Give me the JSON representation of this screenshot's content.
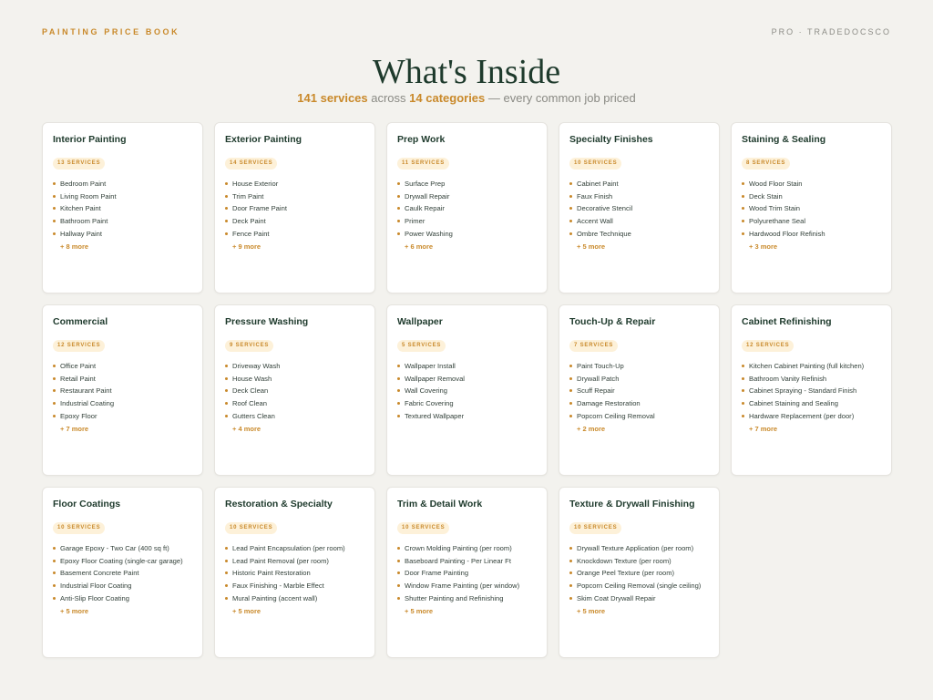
{
  "header": {
    "brand": "PAINTING PRICE BOOK",
    "pro": "PRO · TRADEDOCSCO",
    "title": "What's Inside",
    "subtitle": {
      "services_count": "141 services",
      "across": " across ",
      "categories_count": "14 categories",
      "tail": " — every common job priced"
    }
  },
  "colors": {
    "accent": "#c9892a",
    "title": "#1e3a2c",
    "background": "#f3f2ee",
    "badge_bg": "#fdf1d9"
  },
  "categories": [
    {
      "name": "Interior Painting",
      "badge": "13 SERVICES",
      "items": [
        "Bedroom Paint",
        "Living Room Paint",
        "Kitchen Paint",
        "Bathroom Paint",
        "Hallway Paint"
      ],
      "more": "+ 8 more"
    },
    {
      "name": "Exterior Painting",
      "badge": "14 SERVICES",
      "items": [
        "House Exterior",
        "Trim Paint",
        "Door Frame Paint",
        "Deck Paint",
        "Fence Paint"
      ],
      "more": "+ 9 more"
    },
    {
      "name": "Prep Work",
      "badge": "11 SERVICES",
      "items": [
        "Surface Prep",
        "Drywall Repair",
        "Caulk Repair",
        "Primer",
        "Power Washing"
      ],
      "more": "+ 6 more"
    },
    {
      "name": "Specialty Finishes",
      "badge": "10 SERVICES",
      "items": [
        "Cabinet Paint",
        "Faux Finish",
        "Decorative Stencil",
        "Accent Wall",
        "Ombre Technique"
      ],
      "more": "+ 5 more"
    },
    {
      "name": "Staining & Sealing",
      "badge": "8 SERVICES",
      "items": [
        "Wood Floor Stain",
        "Deck Stain",
        "Wood Trim Stain",
        "Polyurethane Seal",
        "Hardwood Floor Refinish"
      ],
      "more": "+ 3 more"
    },
    {
      "name": "Commercial",
      "badge": "12 SERVICES",
      "items": [
        "Office Paint",
        "Retail Paint",
        "Restaurant Paint",
        "Industrial Coating",
        "Epoxy Floor"
      ],
      "more": "+ 7 more"
    },
    {
      "name": "Pressure Washing",
      "badge": "9 SERVICES",
      "items": [
        "Driveway Wash",
        "House Wash",
        "Deck Clean",
        "Roof Clean",
        "Gutters Clean"
      ],
      "more": "+ 4 more"
    },
    {
      "name": "Wallpaper",
      "badge": "5 SERVICES",
      "items": [
        "Wallpaper Install",
        "Wallpaper Removal",
        "Wall Covering",
        "Fabric Covering",
        "Textured Wallpaper"
      ],
      "more": ""
    },
    {
      "name": "Touch-Up & Repair",
      "badge": "7 SERVICES",
      "items": [
        "Paint Touch-Up",
        "Drywall Patch",
        "Scuff Repair",
        "Damage Restoration",
        "Popcorn Ceiling Removal"
      ],
      "more": "+ 2 more"
    },
    {
      "name": "Cabinet Refinishing",
      "badge": "12 SERVICES",
      "items": [
        "Kitchen Cabinet Painting (full kitchen)",
        "Bathroom Vanity Refinish",
        "Cabinet Spraying - Standard Finish",
        "Cabinet Staining and Sealing",
        "Hardware Replacement (per door)"
      ],
      "more": "+ 7 more"
    },
    {
      "name": "Floor Coatings",
      "badge": "10 SERVICES",
      "items": [
        "Garage Epoxy - Two Car (400 sq ft)",
        "Epoxy Floor Coating (single-car garage)",
        "Basement Concrete Paint",
        "Industrial Floor Coating",
        "Anti-Slip Floor Coating"
      ],
      "more": "+ 5 more"
    },
    {
      "name": "Restoration & Specialty",
      "badge": "10 SERVICES",
      "items": [
        "Lead Paint Encapsulation (per room)",
        "Lead Paint Removal (per room)",
        "Historic Paint Restoration",
        "Faux Finishing - Marble Effect",
        "Mural Painting (accent wall)"
      ],
      "more": "+ 5 more"
    },
    {
      "name": "Trim & Detail Work",
      "badge": "10 SERVICES",
      "items": [
        "Crown Molding Painting (per room)",
        "Baseboard Painting - Per Linear Ft",
        "Door Frame Painting",
        "Window Frame Painting (per window)",
        "Shutter Painting and Refinishing"
      ],
      "more": "+ 5 more"
    },
    {
      "name": "Texture & Drywall Finishing",
      "badge": "10 SERVICES",
      "items": [
        "Drywall Texture Application (per room)",
        "Knockdown Texture (per room)",
        "Orange Peel Texture (per room)",
        "Popcorn Ceiling Removal (single ceiling)",
        "Skim Coat Drywall Repair"
      ],
      "more": "+ 5 more"
    }
  ]
}
